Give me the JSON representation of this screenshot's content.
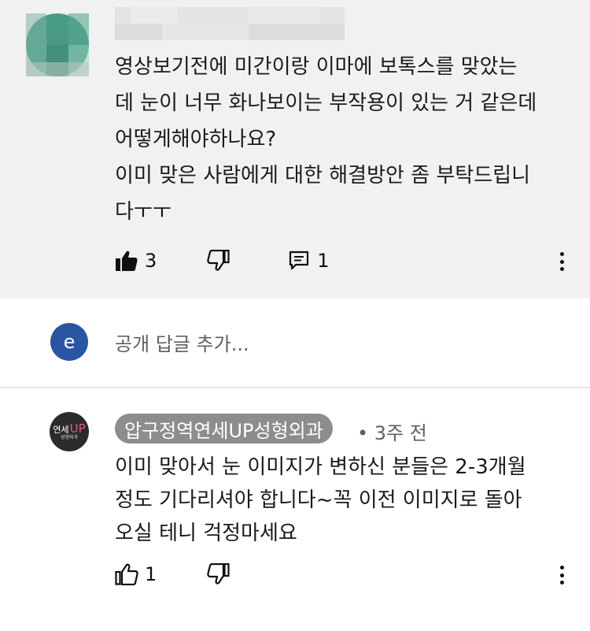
{
  "comment": {
    "author_name": "",
    "lines": [
      "영상보기전에 미간이랑 이마에 보톡스를 맞았는",
      "데 눈이 너무 화나보이는 부작용이 있는 거 같은데",
      "어떻게해야하나요?",
      "이미 맞은 사람에게 대한 해결방안 좀 부탁드립니",
      "다ㅜㅜ"
    ],
    "like_count": "3",
    "reply_count": "1"
  },
  "reply_box": {
    "avatar_letter": "e",
    "placeholder": "공개 답글 추가..."
  },
  "reply": {
    "channel_name": "압구정역연세UP성형외과",
    "avatar_text_main": "연세",
    "avatar_text_accent": "UP",
    "avatar_text_sub": "성형외과",
    "time": "• 3주 전",
    "lines": [
      "이미 맞아서 눈 이미지가 변하신 분들은 2-3개월",
      "정도 기다리셔야 합니다~꼭 이전 이미지로 돌아",
      "오실 테니 걱정마세요"
    ],
    "like_count": "1"
  },
  "colors": {
    "comment_bg": "#f1f1f1",
    "reply_avatar_bg": "#2a55a3",
    "channel_chip_bg": "#8d8d8d",
    "brand_accent": "#e25b77"
  },
  "icons": {
    "like_filled": "thumbs-up-filled-icon",
    "dislike": "thumbs-down-icon",
    "replies": "comment-icon",
    "more": "more-vertical-icon",
    "like_outline": "thumbs-up-outline-icon"
  }
}
